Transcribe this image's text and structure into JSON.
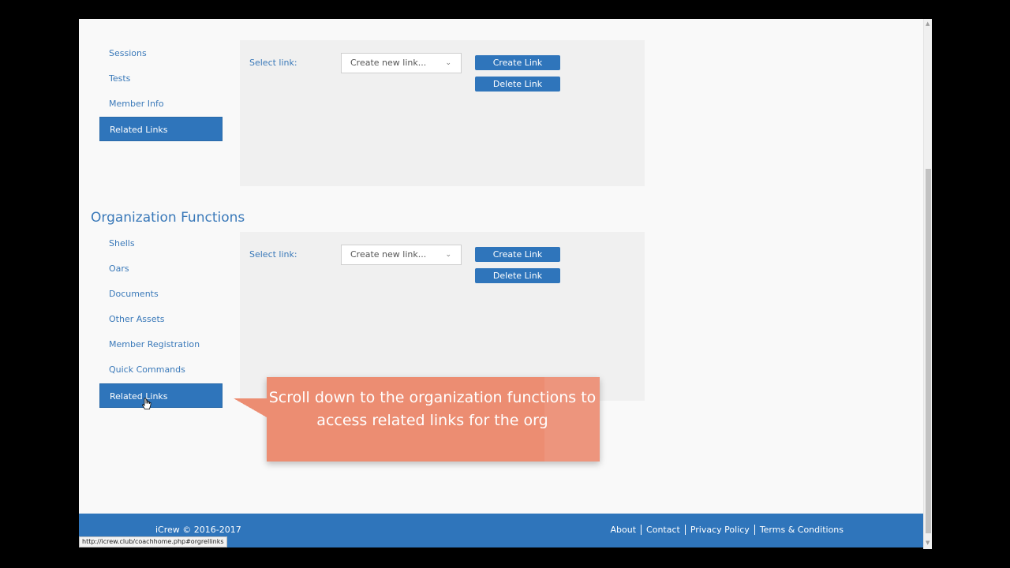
{
  "member_nav": [
    {
      "label": "Sessions",
      "active": false
    },
    {
      "label": "Tests",
      "active": false
    },
    {
      "label": "Member Info",
      "active": false
    },
    {
      "label": "Related Links",
      "active": true
    }
  ],
  "org_section_title": "Organization Functions",
  "org_nav": [
    {
      "label": "Shells",
      "active": false
    },
    {
      "label": "Oars",
      "active": false
    },
    {
      "label": "Documents",
      "active": false
    },
    {
      "label": "Other Assets",
      "active": false
    },
    {
      "label": "Member Registration",
      "active": false
    },
    {
      "label": "Quick Commands",
      "active": false
    },
    {
      "label": "Related Links",
      "active": true
    }
  ],
  "member_panel": {
    "select_label": "Select link:",
    "select_value": "Create new link...",
    "create_button": "Create Link",
    "delete_button": "Delete Link"
  },
  "org_panel": {
    "select_label": "Select link:",
    "select_value": "Create new link...",
    "create_button": "Create Link",
    "delete_button": "Delete Link"
  },
  "callout": {
    "text": "Scroll down to the organization functions to access related links for the org"
  },
  "footer": {
    "copyright": "iCrew © 2016-2017",
    "links": [
      "About",
      "Contact",
      "Privacy Policy",
      "Terms & Conditions"
    ]
  },
  "status_bar_url": "http://icrew.club/coachhome.php#orgrellinks",
  "colors": {
    "accent": "#2f75bb",
    "link_text": "#3a79b9",
    "callout": "#ec8d72"
  }
}
